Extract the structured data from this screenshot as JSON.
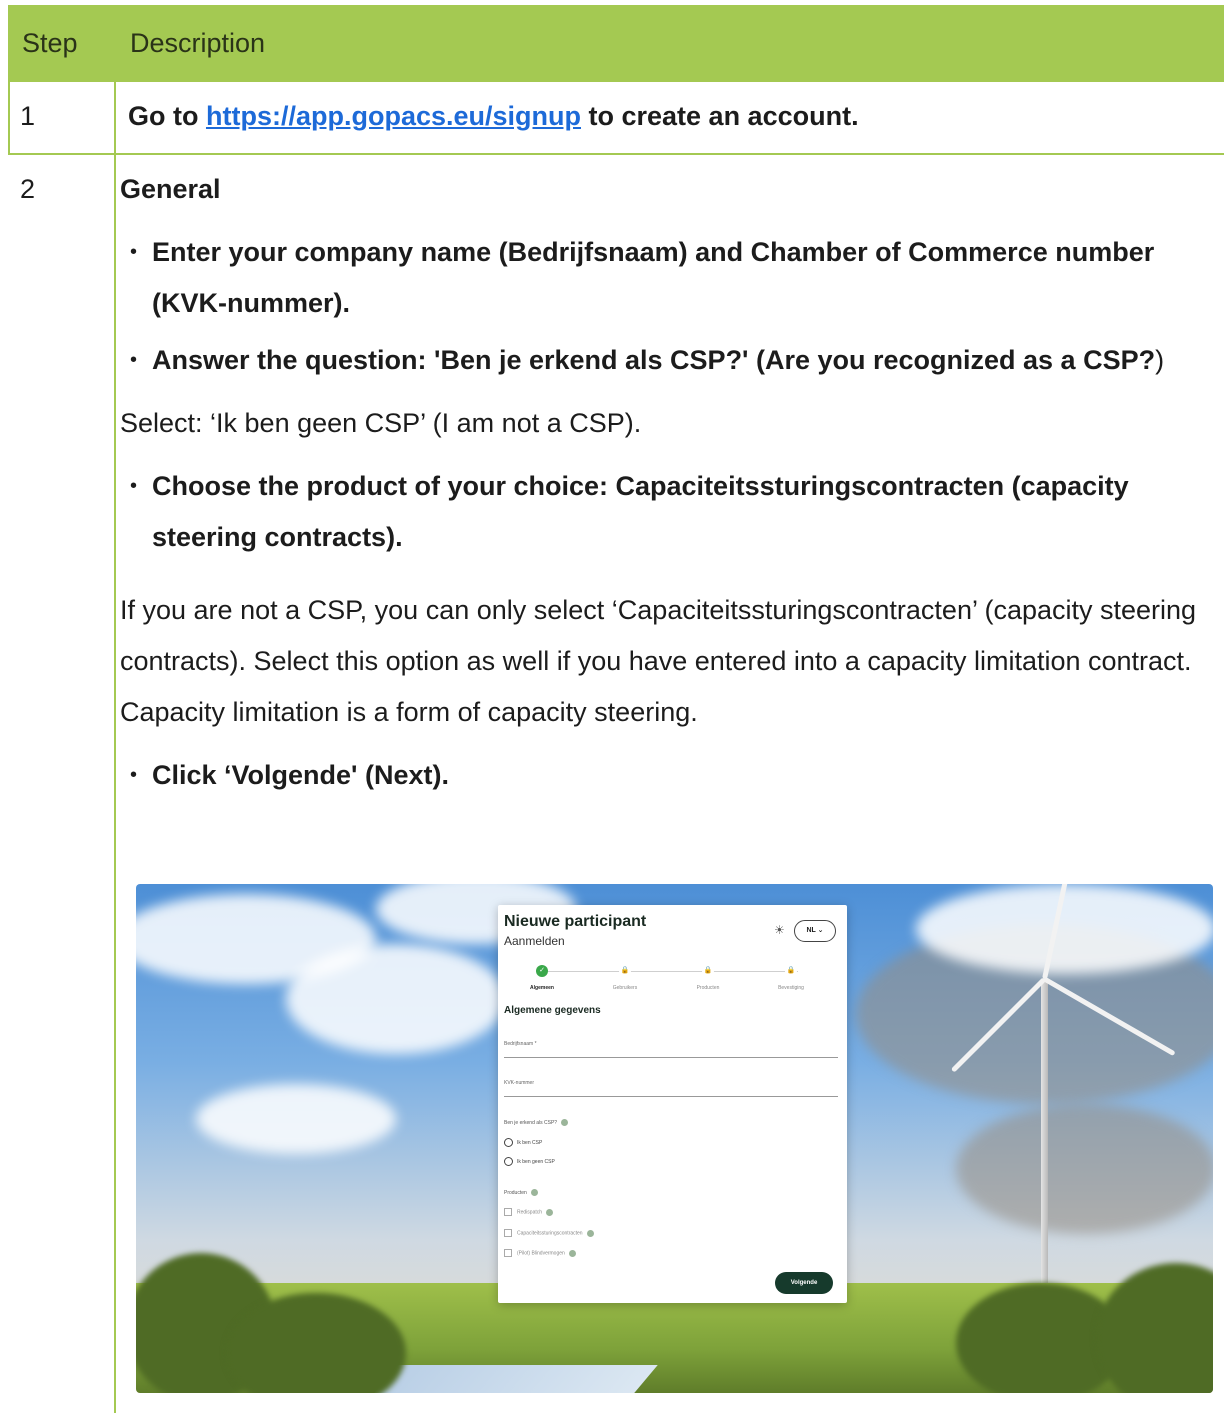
{
  "table": {
    "headers": {
      "step": "Step",
      "description": "Description"
    },
    "row1": {
      "step": "1",
      "prefix": "Go to ",
      "link": "https://app.gopacs.eu/signup",
      "suffix": " to create an account."
    },
    "row2": {
      "step": "2",
      "heading": "General",
      "bullet1": "Enter your company name (Bedrijfsnaam) and Chamber of Commerce number (KVK-nummer).",
      "bullet2_bold": "Answer the question: 'Ben je erkend als CSP?' (Are you recognized as a CSP?",
      "bullet2_tail": ")",
      "para1": "Select: ‘Ik ben geen CSP’ (I am not a CSP).",
      "bullet3": "Choose the product of your choice: Capaciteitssturingscontracten (capacity steering contracts).",
      "para2": "If you are not a CSP, you can only select ‘Capaciteitssturingscontracten’ (capacity steering contracts). Select this option as well if you have entered into a capacity limitation contract. Capacity limitation is a form of capacity steering.",
      "bullet4": "Click ‘Volgende' (Next)."
    }
  },
  "screenshot": {
    "title": "Nieuwe participant",
    "subtitle": "Aanmelden",
    "language": "NL ⌄",
    "steps": [
      "Algemeen",
      "Gebruikers",
      "Producten",
      "Bevestiging"
    ],
    "section": "Algemene gegevens",
    "field_company": "Bedrijfsnaam *",
    "field_kvk": "KVK-nummer",
    "question": "Ben je erkend als CSP?",
    "radio1": "Ik ben CSP",
    "radio2": "Ik ben geen CSP",
    "products_label": "Producten",
    "product1": "Redispatch",
    "product2": "Capaciteitssturingscontracten",
    "product3": "(Pilot) Blindvermogen",
    "button": "Volgende"
  },
  "colors": {
    "header_bg": "#a4c952",
    "link": "#1d6ad8",
    "button": "#163a2c",
    "step_active": "#3aa84a"
  }
}
